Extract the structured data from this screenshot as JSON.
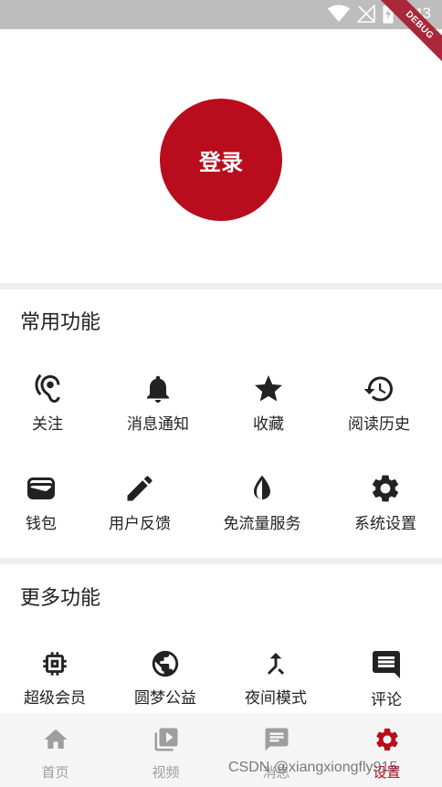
{
  "status_bar": {
    "time": "1:43",
    "icons": [
      "wifi-icon",
      "signal-off-icon",
      "battery-charging-icon"
    ]
  },
  "debug_banner": "DEBUG",
  "login": {
    "label": "登录",
    "color": "#b90c1c"
  },
  "common_section": {
    "title": "常用功能",
    "items": [
      {
        "label": "关注",
        "icon": "hearing-icon"
      },
      {
        "label": "消息通知",
        "icon": "bell-icon"
      },
      {
        "label": "收藏",
        "icon": "star-icon"
      },
      {
        "label": "阅读历史",
        "icon": "history-icon"
      },
      {
        "label": "钱包",
        "icon": "wallet-icon"
      },
      {
        "label": "用户反馈",
        "icon": "pencil-icon"
      },
      {
        "label": "免流量服务",
        "icon": "contrast-icon"
      },
      {
        "label": "系统设置",
        "icon": "gear-icon"
      }
    ]
  },
  "more_section": {
    "title": "更多功能",
    "items": [
      {
        "label": "超级会员",
        "icon": "chip-icon"
      },
      {
        "label": "圆梦公益",
        "icon": "globe-icon"
      },
      {
        "label": "夜间模式",
        "icon": "merge-icon"
      },
      {
        "label": "评论",
        "icon": "comment-icon"
      }
    ]
  },
  "bottom_nav": {
    "items": [
      {
        "label": "首页",
        "icon": "home-icon",
        "active": false
      },
      {
        "label": "视频",
        "icon": "video-library-icon",
        "active": false
      },
      {
        "label": "消息",
        "icon": "message-icon",
        "active": false
      },
      {
        "label": "设置",
        "icon": "gear-icon",
        "active": true
      }
    ],
    "active_color": "#b90c1c",
    "inactive_color": "#9e9e9e"
  },
  "watermark": "CSDN @xiangxiongfly915"
}
